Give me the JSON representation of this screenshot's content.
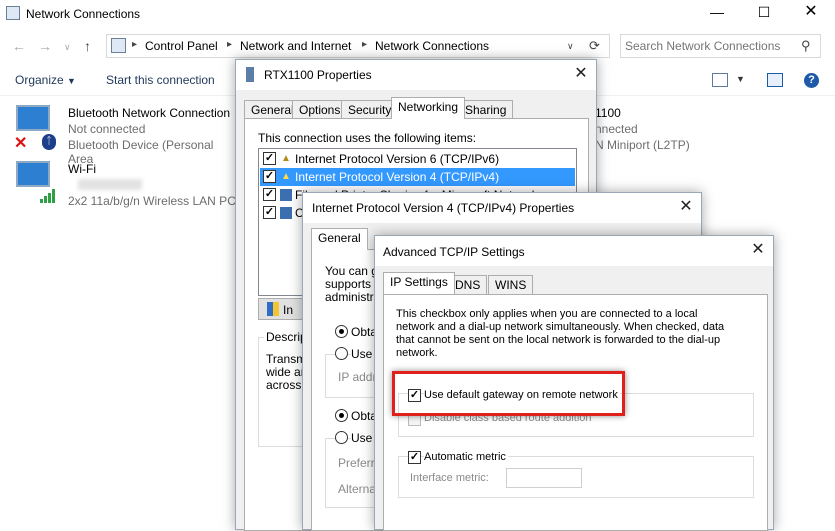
{
  "window": {
    "title": "Network Connections"
  },
  "address": {
    "crumbs": [
      "Control Panel",
      "Network and Internet",
      "Network Connections"
    ],
    "search_placeholder": "Search Network Connections"
  },
  "toolbar": {
    "organize": "Organize",
    "start_connection": "Start this connection"
  },
  "connections": [
    {
      "name": "Bluetooth Network Connection",
      "status": "Not connected",
      "device": "Bluetooth Device (Personal Area"
    },
    {
      "name": "Wi-Fi",
      "status": "",
      "device": "2x2 11a/b/g/n Wireless LAN PCI"
    }
  ],
  "vpn_partial": {
    "name_fragment": "1100",
    "status_fragment": "nnected",
    "device_fragment": "N Miniport (L2TP)"
  },
  "rtx_dialog": {
    "title": "RTX1100 Properties",
    "tabs": [
      "General",
      "Options",
      "Security",
      "Networking",
      "Sharing"
    ],
    "items_label": "This connection uses the following items:",
    "items": [
      {
        "label": "Internet Protocol Version 6 (TCP/IPv6)",
        "checked": true
      },
      {
        "label": "Internet Protocol Version 4 (TCP/IPv4)",
        "checked": true
      },
      {
        "label": "File and Printer Sharing for Microsoft Networks",
        "checked": true
      },
      {
        "label": "Cl",
        "checked": true
      }
    ],
    "install_fragment": "In",
    "description_label": "Descrip",
    "description_lines": [
      "Transm",
      "wide ar",
      "across"
    ]
  },
  "ipv4_dialog": {
    "title": "Internet Protocol Version 4 (TCP/IPv4) Properties",
    "tab": "General",
    "intro_lines": [
      "You can g",
      "supports th",
      "administrat"
    ],
    "obtain_ip": "Obtai",
    "use_ip": "Use t",
    "ip_address": "IP addre",
    "obtain_dns": "Obtai",
    "use_dns": "Use t",
    "preferred": "Preferre",
    "alternate": "Alternat"
  },
  "adv_dialog": {
    "title": "Advanced TCP/IP Settings",
    "tabs": [
      "IP Settings",
      "DNS",
      "WINS"
    ],
    "info_lines": [
      "This checkbox only applies when you are connected to a local",
      "network and a dial-up network simultaneously.  When checked, data",
      "that cannot be sent on the local network is forwarded to the dial-up",
      "network."
    ],
    "use_default_gateway": "Use default gateway on remote network",
    "disable_class_route": "Disable class based route addition",
    "automatic_metric": "Automatic metric",
    "interface_metric": "Interface metric:"
  },
  "colors": {
    "selection": "#3399ff",
    "highlight_border": "#e0201b",
    "link_text": "#1e395b"
  }
}
